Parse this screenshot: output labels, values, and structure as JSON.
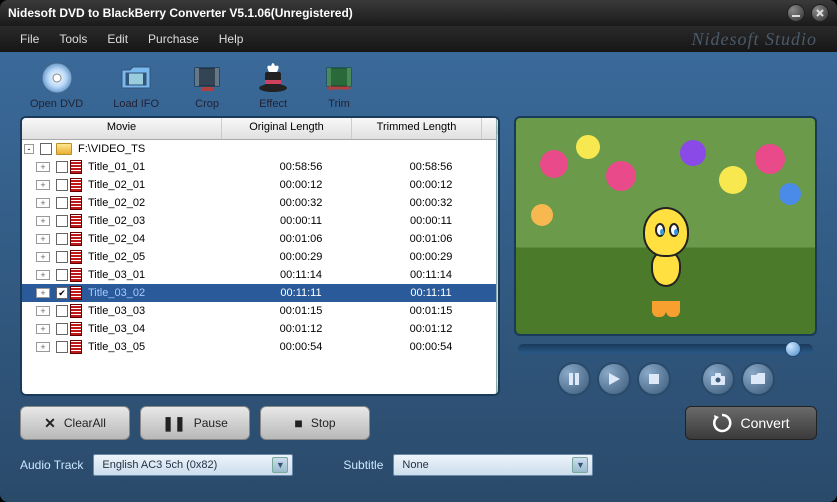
{
  "title": "Nidesoft DVD to BlackBerry Converter V5.1.06(Unregistered)",
  "brand": "Nidesoft Studio",
  "menu": {
    "file": "File",
    "tools": "Tools",
    "edit": "Edit",
    "purchase": "Purchase",
    "help": "Help"
  },
  "toolbar": {
    "open_dvd": "Open DVD",
    "load_ifo": "Load IFO",
    "crop": "Crop",
    "effect": "Effect",
    "trim": "Trim"
  },
  "list": {
    "headers": {
      "movie": "Movie",
      "original": "Original Length",
      "trimmed": "Trimmed Length"
    },
    "root": "F:\\VIDEO_TS",
    "rows": [
      {
        "name": "Title_01_01",
        "orig": "00:58:56",
        "trim": "00:58:56",
        "sel": false
      },
      {
        "name": "Title_02_01",
        "orig": "00:00:12",
        "trim": "00:00:12",
        "sel": false
      },
      {
        "name": "Title_02_02",
        "orig": "00:00:32",
        "trim": "00:00:32",
        "sel": false
      },
      {
        "name": "Title_02_03",
        "orig": "00:00:11",
        "trim": "00:00:11",
        "sel": false
      },
      {
        "name": "Title_02_04",
        "orig": "00:01:06",
        "trim": "00:01:06",
        "sel": false
      },
      {
        "name": "Title_02_05",
        "orig": "00:00:29",
        "trim": "00:00:29",
        "sel": false
      },
      {
        "name": "Title_03_01",
        "orig": "00:11:14",
        "trim": "00:11:14",
        "sel": false
      },
      {
        "name": "Title_03_02",
        "orig": "00:11:11",
        "trim": "00:11:11",
        "sel": true
      },
      {
        "name": "Title_03_03",
        "orig": "00:01:15",
        "trim": "00:01:15",
        "sel": false
      },
      {
        "name": "Title_03_04",
        "orig": "00:01:12",
        "trim": "00:01:12",
        "sel": false
      },
      {
        "name": "Title_03_05",
        "orig": "00:00:54",
        "trim": "00:00:54",
        "sel": false
      }
    ]
  },
  "buttons": {
    "clear_all": "ClearAll",
    "pause": "Pause",
    "stop": "Stop",
    "convert": "Convert"
  },
  "bottom": {
    "audio_label": "Audio Track",
    "audio_value": "English AC3 5ch (0x82)",
    "subtitle_label": "Subtitle",
    "subtitle_value": "None"
  }
}
